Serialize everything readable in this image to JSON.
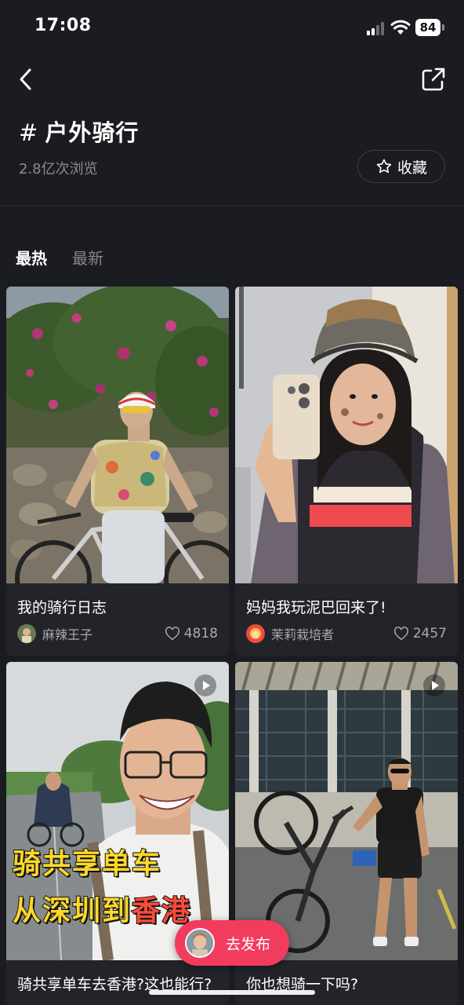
{
  "status_bar": {
    "time": "17:08",
    "battery": "84"
  },
  "header": {
    "hash": "#",
    "topic": "户外骑行",
    "views": "2.8亿次浏览",
    "favorite_label": "收藏"
  },
  "tabs": [
    {
      "label": "最热",
      "active": true
    },
    {
      "label": "最新",
      "active": false
    }
  ],
  "posts": [
    {
      "title": "我的骑行日志",
      "author": "麻辣王子",
      "likes": "4818",
      "video": false
    },
    {
      "title": "妈妈我玩泥巴回来了!",
      "author": "茉莉栽培者",
      "likes": "2457",
      "video": false
    },
    {
      "title": "骑共享单车去香港?这也能行?",
      "video": true,
      "overlay_line1": "骑共享单车",
      "overlay_line2a": "从深圳到",
      "overlay_line2b": "香港"
    },
    {
      "title": "你也想骑一下吗?",
      "video": true
    }
  ],
  "publish_button": {
    "label": "去发布"
  },
  "colors": {
    "accent": "#f23c5e",
    "background": "#1b1c21",
    "card": "#232429",
    "overlay_yellow": "#ffd829"
  }
}
